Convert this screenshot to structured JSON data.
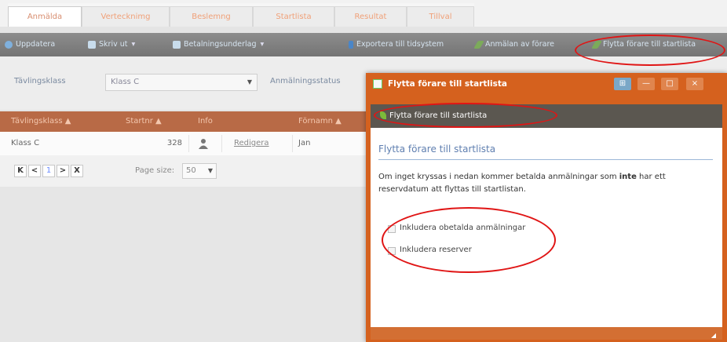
{
  "tabs": [
    "Anmälda",
    "Vertecknimg",
    "Beslemng",
    "Startlista",
    "Resultat",
    "Tillval"
  ],
  "toolbar": {
    "refresh": "Uppdatera",
    "print": "Skriv ut",
    "payment": "Betalningsunderlag",
    "export": "Exportera till tidsystem",
    "signup": "Anmälan av förare",
    "move": "Flytta förare till startlista"
  },
  "filter": {
    "class_label": "Tävlingsklass",
    "class_value": "Klass C",
    "status_label": "Anmälningsstatus"
  },
  "grid": {
    "headers": [
      "Tävlingsklass ▲",
      "Startnr ▲",
      "Info",
      "Förnamn ▲"
    ],
    "row": {
      "class": "Klass C",
      "startnr": "328",
      "edit": "Redigera",
      "firstname": "Jan"
    }
  },
  "pager": {
    "first": "K",
    "prev": "<",
    "page": "1",
    "next": ">",
    "last": "X",
    "size_label": "Page size:",
    "size_value": "50"
  },
  "dialog": {
    "title": "Flytta förare till startlista",
    "subtitle": "Flytta förare till startlista",
    "heading": "Flytta förare till startlista",
    "text_before": "Om inget kryssas i nedan kommer betalda anmälningar som ",
    "text_bold": "inte",
    "text_after": " har ett reservdatum att flyttas till startlistan.",
    "chk_unpaid": "Inkludera obetalda anmälningar",
    "chk_reserves": "Inkludera reserver"
  },
  "icons": {
    "refresh": "refresh-icon",
    "print": "printer-icon",
    "payment": "document-icon",
    "export": "export-icon",
    "signup": "leaf-icon",
    "move": "leaf-icon"
  },
  "colors": {
    "accent": "#d5611e",
    "header": "#b86a46",
    "toolbar": "#7d7d7d",
    "ring": "#e01515"
  }
}
